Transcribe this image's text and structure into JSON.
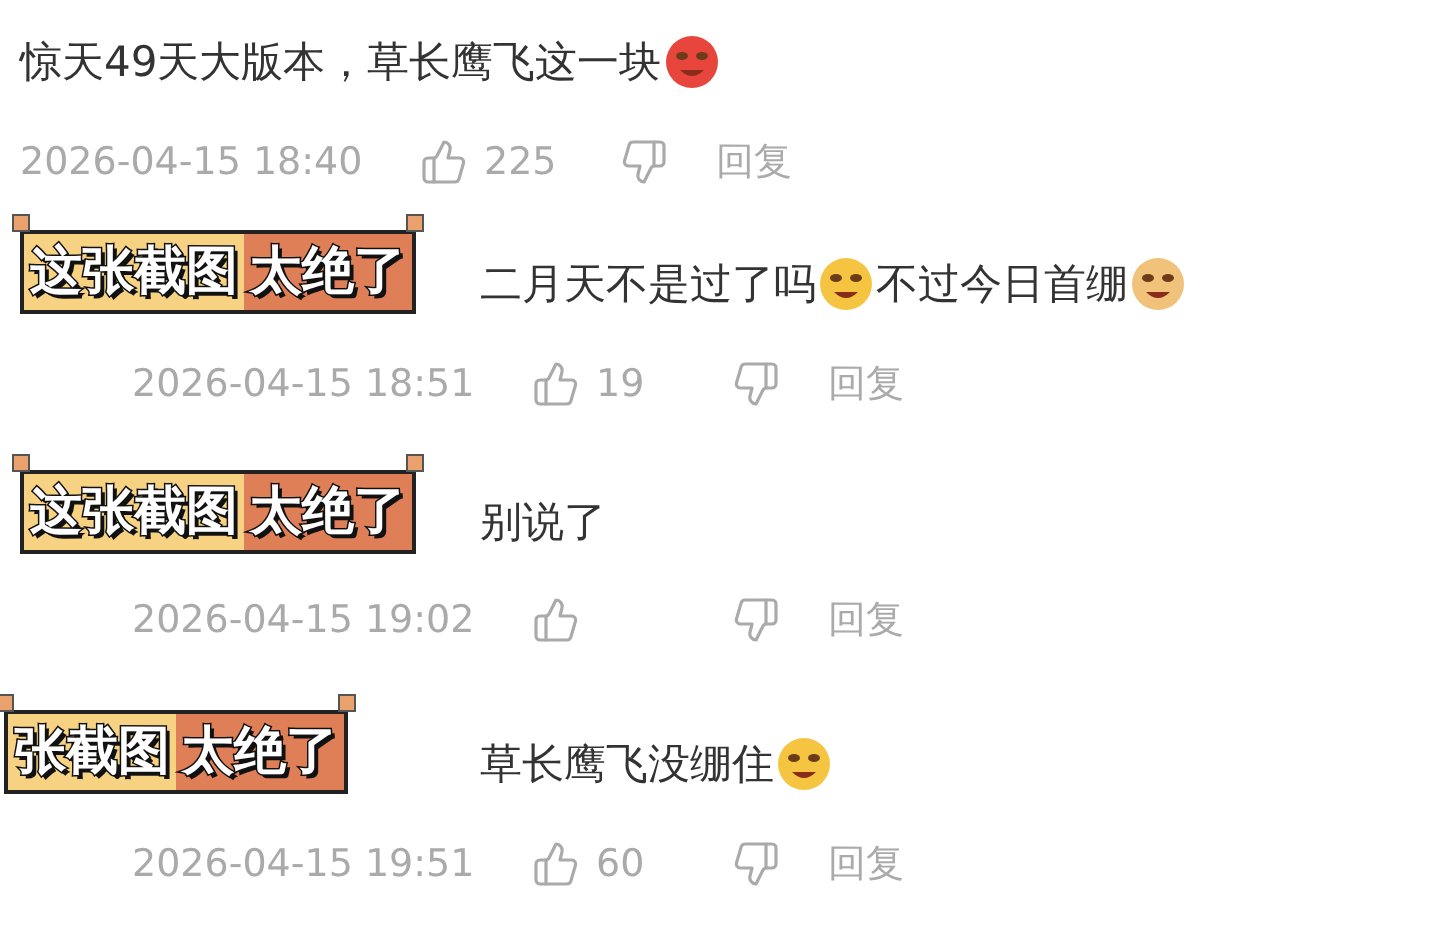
{
  "comments": [
    {
      "parts": [
        {
          "kind": "text",
          "text": "惊天49天大版本，草长鹰飞这一块"
        },
        {
          "kind": "emoji",
          "color": "#e8463c"
        }
      ],
      "time": "2026-04-15 18:40",
      "likes": "225",
      "reply": "回复",
      "reply_level": false
    },
    {
      "overlay": {
        "left": "这张截图",
        "right": "太绝了"
      },
      "parts": [
        {
          "kind": "text",
          "text": "二月天不是过了吗"
        },
        {
          "kind": "emoji",
          "color": "#f5c542"
        },
        {
          "kind": "text",
          "text": "不过今日首绷"
        },
        {
          "kind": "emoji",
          "color": "#f0c27a"
        }
      ],
      "time": "2026-04-15 18:51",
      "likes": "19",
      "reply": "回复",
      "reply_level": true
    },
    {
      "overlay": {
        "left": "这张截图",
        "right": "太绝了"
      },
      "parts": [
        {
          "kind": "text",
          "text": "别说了"
        }
      ],
      "time": "2026-04-15 19:02",
      "reply": "回复",
      "reply_level": true
    },
    {
      "overlay": {
        "left": "张截图",
        "right": "太绝了"
      },
      "parts": [
        {
          "kind": "text",
          "text": "草长鹰飞没绷住"
        },
        {
          "kind": "emoji",
          "color": "#f5c542"
        }
      ],
      "time": "2026-04-15 19:51",
      "likes": "60",
      "reply": "回复",
      "reply_level": true
    }
  ]
}
